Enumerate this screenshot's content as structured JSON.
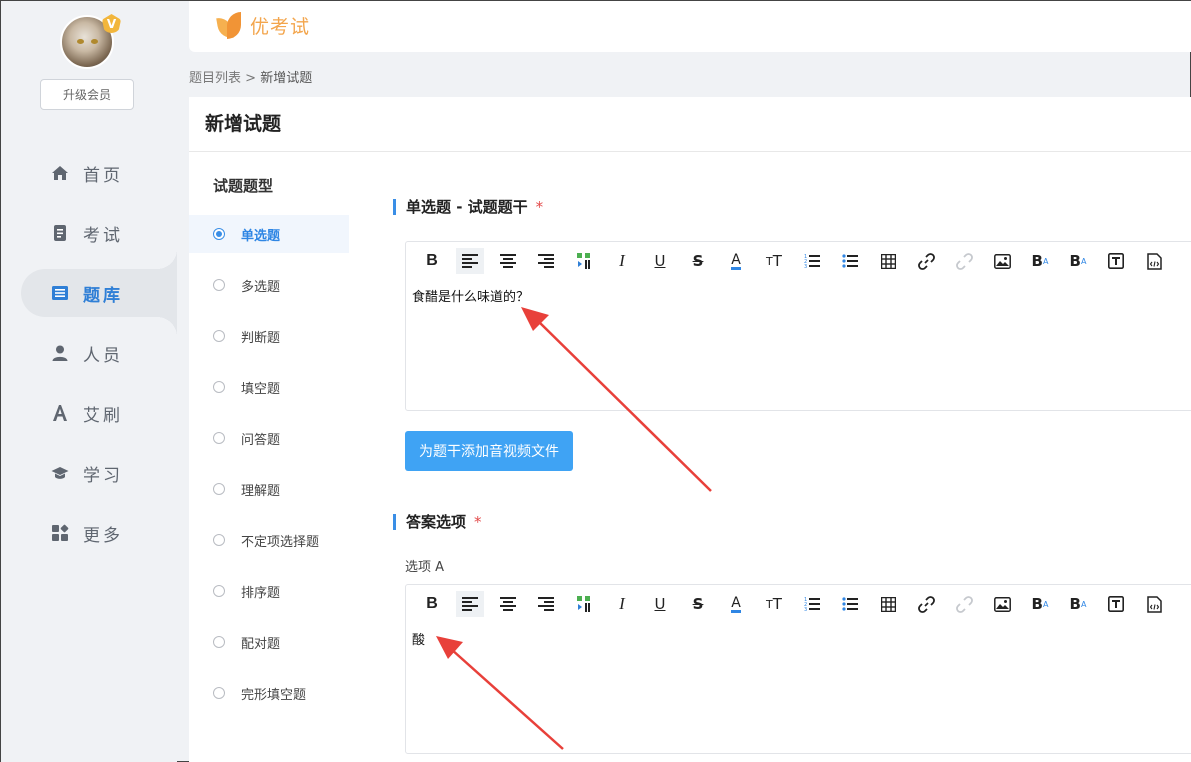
{
  "sidebar": {
    "vip_badge": "V",
    "upgrade_label": "升级会员",
    "items": [
      {
        "label": "首页",
        "icon": "home-icon"
      },
      {
        "label": "考试",
        "icon": "exam-icon"
      },
      {
        "label": "题库",
        "icon": "question-bank-icon",
        "active": true
      },
      {
        "label": "人员",
        "icon": "person-icon"
      },
      {
        "label": "艾刷",
        "icon": "brush-icon"
      },
      {
        "label": "学习",
        "icon": "graduation-cap-icon"
      },
      {
        "label": "更多",
        "icon": "more-grid-icon"
      }
    ]
  },
  "header": {
    "logo_text": "优考试"
  },
  "breadcrumb": {
    "parent": "题目列表",
    "separator": " > ",
    "current": "新增试题"
  },
  "page": {
    "title": "新增试题",
    "qtype_title": "试题题型",
    "qtypes": [
      "单选题",
      "多选题",
      "判断题",
      "填空题",
      "问答题",
      "理解题",
      "不定项选择题",
      "排序题",
      "配对题",
      "完形填空题"
    ],
    "selected_qtype": "单选题",
    "stem_section_title": "单选题 - 试题题干",
    "required_mark": "*",
    "stem_content": "食醋是什么味道的？",
    "media_button": "为题干添加音视频文件",
    "answer_section_title": "答案选项",
    "option_a_label": "选项 A",
    "option_a_content": "酸"
  },
  "colors": {
    "accent": "#3a8ee6",
    "brand_orange": "#f3a54c",
    "annotation_arrow": "#e8403a"
  }
}
